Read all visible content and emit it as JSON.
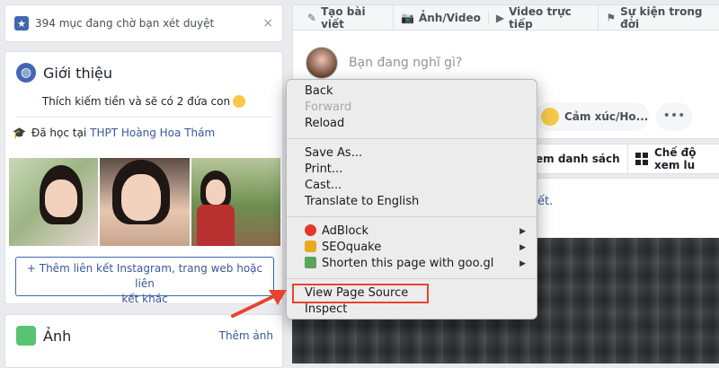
{
  "pending": {
    "text": "394 mục đang chờ bạn xét duyệt",
    "close": "×"
  },
  "intro": {
    "title": "Giới thiệu",
    "bio": "Thích kiếm tiền và sẽ có 2 đứa con",
    "education_prefix": "Đã học tại",
    "school": "THPT Hoàng Hoa Thám",
    "add_link_line1": "+ Thêm liên kết Instagram, trang web hoặc liên",
    "add_link_line2": "kết khác"
  },
  "album": {
    "title": "Ảnh",
    "more": "Thêm ảnh"
  },
  "composer": {
    "tabs": [
      {
        "icon": "✎",
        "label": "Tạo bài viết"
      },
      {
        "icon": "📷",
        "label": "Ảnh/Video"
      },
      {
        "icon": "▶",
        "label": "Video trực tiếp"
      },
      {
        "icon": "⚑",
        "label": "Sự kiện trong đời"
      }
    ],
    "prompt": "Bạn đang nghĩ gì?",
    "feeling": "Cảm xúc/Ho...",
    "more": "•••"
  },
  "feedbar": {
    "view_list": "em danh sách",
    "view_mode": "Chế độ xem lu"
  },
  "post": {
    "trailing_text": "ết."
  },
  "context_menu": {
    "items_group1": [
      {
        "label": "Back",
        "disabled": false
      },
      {
        "label": "Forward",
        "disabled": true
      },
      {
        "label": "Reload",
        "disabled": false
      }
    ],
    "items_group2": [
      {
        "label": "Save As..."
      },
      {
        "label": "Print..."
      },
      {
        "label": "Cast..."
      },
      {
        "label": "Translate to English"
      }
    ],
    "items_group3": [
      {
        "label": "AdBlock",
        "submenu": "▶"
      },
      {
        "label": "SEOquake",
        "submenu": "▶"
      },
      {
        "label": "Shorten this page with goo.gl",
        "submenu": "▶"
      }
    ],
    "items_group4": [
      {
        "label": "View Page Source",
        "highlighted": true
      },
      {
        "label": "Inspect"
      }
    ]
  },
  "colors": {
    "fb_blue": "#4267b2",
    "link": "#385898",
    "highlight": "#e8432f"
  }
}
